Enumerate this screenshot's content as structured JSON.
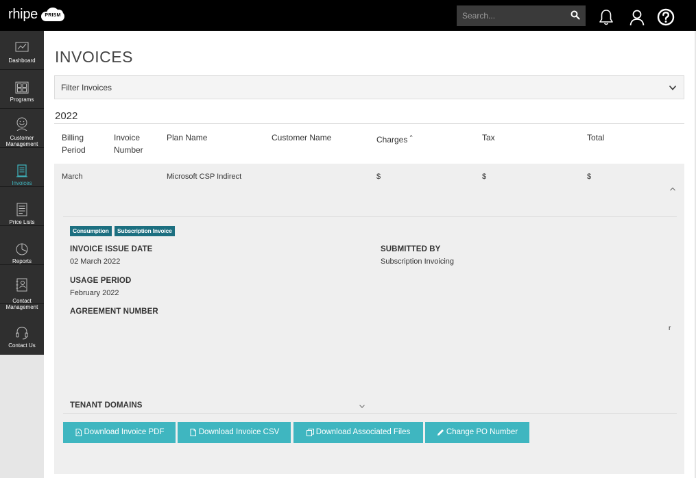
{
  "header": {
    "logo_text": "rhipe",
    "logo_badge": "PRISM",
    "search_placeholder": "Search...",
    "icons": [
      "bell-icon",
      "user-icon",
      "help-icon"
    ]
  },
  "sidebar": {
    "items": [
      {
        "label": "Dashboard",
        "icon": "chart-icon",
        "active": false
      },
      {
        "label": "Programs",
        "icon": "grid-icon",
        "active": false
      },
      {
        "label": "Customer Management",
        "label_line1": "Customer",
        "label_line2": "Management",
        "icon": "smiley-icon",
        "active": false
      },
      {
        "label": "Invoices",
        "icon": "invoice-icon",
        "active": true
      },
      {
        "label": "Price Lists",
        "icon": "list-icon",
        "active": false
      },
      {
        "label": "Reports",
        "icon": "pie-icon",
        "active": false
      },
      {
        "label": "Contact Management",
        "label_line1": "Contact",
        "label_line2": "Management",
        "icon": "contact-book-icon",
        "active": false
      },
      {
        "label": "Contact Us",
        "icon": "headset-icon",
        "active": false
      }
    ],
    "active_color": "#3fb6c0"
  },
  "main": {
    "title": "INVOICES",
    "filter_label": "Filter Invoices",
    "year": "2022",
    "table": {
      "headers": {
        "billing_period_1": "Billing",
        "billing_period_2": "Period",
        "invoice_number_1": "Invoice",
        "invoice_number_2": "Number",
        "plan_name": "Plan Name",
        "customer_name": "Customer Name",
        "charges": "Charges",
        "charges_sort": "^",
        "tax": "Tax",
        "total": "Total"
      },
      "row": {
        "billing_period": "March",
        "plan_name": "Microsoft CSP Indirect",
        "charges": "$",
        "tax": "$",
        "total": "$"
      }
    },
    "details": {
      "badges": [
        "Consumption",
        "Subscription Invoice"
      ],
      "invoice_issue_date_label": "INVOICE ISSUE DATE",
      "invoice_issue_date": "02 March 2022",
      "submitted_by_label": "SUBMITTED BY",
      "submitted_by": "Subscription Invoicing",
      "usage_period_label": "USAGE PERIOD",
      "usage_period": "February 2022",
      "agreement_number_label": "AGREEMENT NUMBER",
      "stray_char": "r",
      "tenant_domains_label": "TENANT DOMAINS"
    },
    "buttons": {
      "pdf": "Download Invoice PDF",
      "csv": "Download Invoice CSV",
      "associated": "Download Associated Files",
      "po": "Change PO Number"
    },
    "colors": {
      "accent": "#3fb6c0",
      "badge": "#1c6f80",
      "topbar": "#000000",
      "sidebar": "#2f2f2f"
    }
  }
}
